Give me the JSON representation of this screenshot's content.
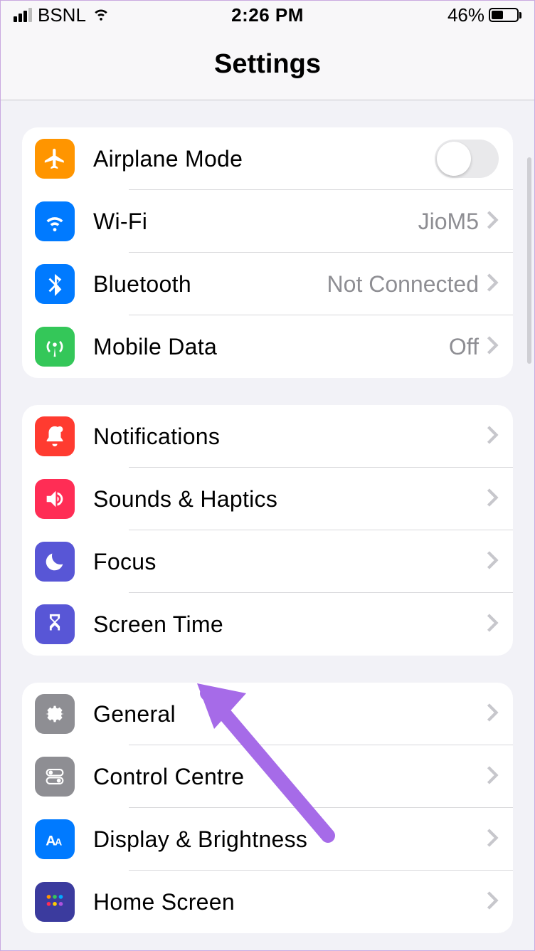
{
  "status": {
    "carrier": "BSNL",
    "time": "2:26 PM",
    "battery_pct": "46%"
  },
  "nav": {
    "title": "Settings"
  },
  "groups": [
    {
      "rows": [
        {
          "label": "Airplane Mode",
          "detail": "",
          "toggle": true,
          "icon": "airplane"
        },
        {
          "label": "Wi-Fi",
          "detail": "JioM5",
          "icon": "wifi"
        },
        {
          "label": "Bluetooth",
          "detail": "Not Connected",
          "icon": "bluetooth"
        },
        {
          "label": "Mobile Data",
          "detail": "Off",
          "icon": "antenna"
        }
      ]
    },
    {
      "rows": [
        {
          "label": "Notifications",
          "detail": "",
          "icon": "bell"
        },
        {
          "label": "Sounds & Haptics",
          "detail": "",
          "icon": "speaker"
        },
        {
          "label": "Focus",
          "detail": "",
          "icon": "moon"
        },
        {
          "label": "Screen Time",
          "detail": "",
          "icon": "hourglass"
        }
      ]
    },
    {
      "rows": [
        {
          "label": "General",
          "detail": "",
          "icon": "gear"
        },
        {
          "label": "Control Centre",
          "detail": "",
          "icon": "toggles"
        },
        {
          "label": "Display & Brightness",
          "detail": "",
          "icon": "aa"
        },
        {
          "label": "Home Screen",
          "detail": "",
          "icon": "grid"
        }
      ]
    }
  ]
}
